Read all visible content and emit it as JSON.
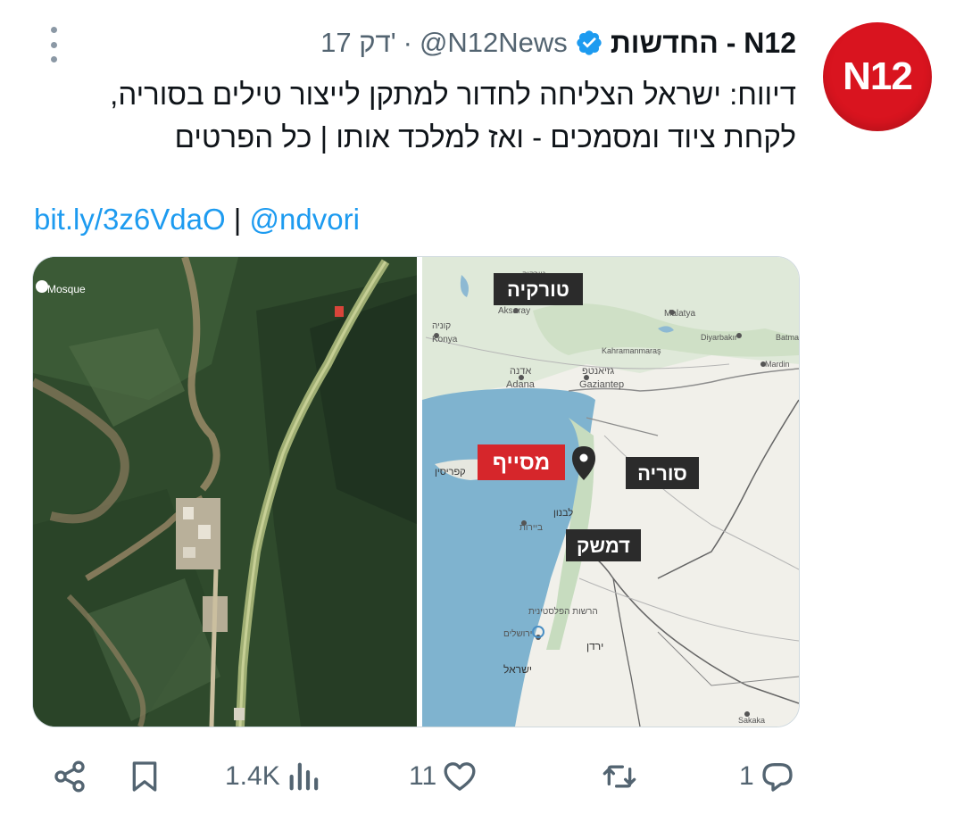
{
  "tweet": {
    "author": {
      "display_name": "החדשות - N12",
      "handle": "@N12News",
      "separator": "·",
      "time": "17 דק'",
      "avatar_text": "N12",
      "verified": true
    },
    "text_line1": "דיווח: ישראל הצליחה לחדור למתקן לייצור טילים בסוריה,",
    "text_line2": "לקחת ציוד ומסמכים - ואז למלכד אותו | כל הפרטים",
    "link": "bit.ly/3z6VdaO",
    "link_separator": "|",
    "mention": "@ndvori"
  },
  "media": {
    "satellite": {
      "mosque_label": "Mosque"
    },
    "map": {
      "labels": {
        "turkey": "טורקיה",
        "syria": "סוריה",
        "damascus": "דמשק",
        "masyaf": "מסייף",
        "cyprus": "קפריסין",
        "lebanon": "לבנון",
        "israel": "ישראל",
        "jordan": "ירדן",
        "beirut": "ביירות",
        "adana_he": "אדנה",
        "adana": "Adana",
        "gaziantep_he": "גזיאנטפ",
        "gaziantep": "Gaziantep",
        "konya_he": "קוניה",
        "konya": "Konya",
        "aksaray": "Aksaray",
        "malatya": "Malatya",
        "diyarbakir": "Diyarbakır",
        "batman": "Batman",
        "mardin": "Mardin",
        "kahramanmaras": "Kahramanmaraş",
        "sakaka": "Sakaka",
        "turkey_small": "טורקיה",
        "palestine": "הרשות הפלסטינית",
        "jerusalem": "ירושלים"
      }
    }
  },
  "colors": {
    "accent": "#1d9bf0",
    "brand_red": "#d9141f",
    "masyaf_red": "#d6262b",
    "sea": "#7fb3cf"
  },
  "actions": {
    "replies": "1",
    "retweets": "",
    "likes": "11",
    "views": "1.4K",
    "icons": [
      "reply-icon",
      "retweet-icon",
      "like-icon",
      "views-icon",
      "bookmark-icon",
      "share-icon"
    ]
  }
}
